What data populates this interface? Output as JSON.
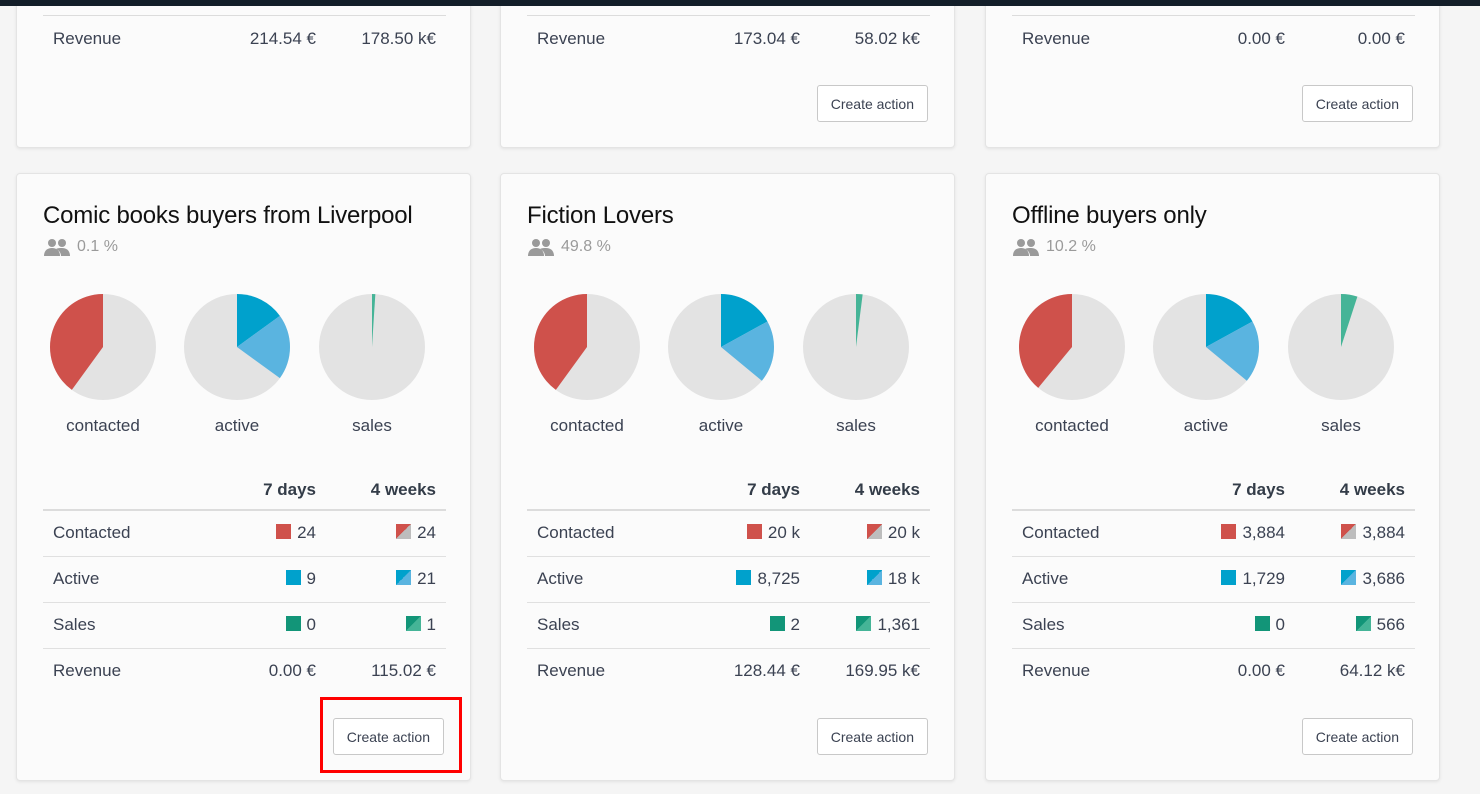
{
  "colors": {
    "contacted": "#cf514b",
    "contacted_secondary": "#bdbdbd",
    "active": "#00a1cc",
    "active_secondary": "#5ab4e0",
    "sales": "#129578",
    "sales_secondary": "#45b497",
    "pie_background": "#e3e3e3",
    "highlight": "#ff0000"
  },
  "columns": {
    "recent": "7 days",
    "period": "4 weeks"
  },
  "row_labels": {
    "contacted": "Contacted",
    "active": "Active",
    "sales": "Sales",
    "revenue": "Revenue"
  },
  "pie_labels": {
    "contacted": "contacted",
    "active": "active",
    "sales": "sales"
  },
  "create_action_label": "Create action",
  "top_cards": [
    {
      "revenue_7d": "214.54 €",
      "revenue_4w": "178.50 k€",
      "has_button": false
    },
    {
      "revenue_7d": "173.04 €",
      "revenue_4w": "58.02 k€",
      "has_button": true
    },
    {
      "revenue_7d": "0.00 €",
      "revenue_4w": "0.00 €",
      "has_button": true
    }
  ],
  "segments": [
    {
      "title": "Comic books buyers from Liverpool",
      "share": "0.1 %",
      "pies": {
        "contacted": 0.4,
        "active_recent": 0.15,
        "active_period": 0.2,
        "sales": 0.01
      },
      "contacted_7d": "24",
      "contacted_4w": "24",
      "active_7d": "9",
      "active_4w": "21",
      "sales_7d": "0",
      "sales_4w": "1",
      "revenue_7d": "0.00 €",
      "revenue_4w": "115.02 €",
      "highlighted": true
    },
    {
      "title": "Fiction Lovers",
      "share": "49.8 %",
      "pies": {
        "contacted": 0.4,
        "active_recent": 0.17,
        "active_period": 0.19,
        "sales": 0.02
      },
      "contacted_7d": "20 k",
      "contacted_4w": "20 k",
      "active_7d": "8,725",
      "active_4w": "18 k",
      "sales_7d": "2",
      "sales_4w": "1,361",
      "revenue_7d": "128.44 €",
      "revenue_4w": "169.95 k€",
      "highlighted": false
    },
    {
      "title": "Offline buyers only",
      "share": "10.2 %",
      "pies": {
        "contacted": 0.39,
        "active_recent": 0.17,
        "active_period": 0.19,
        "sales": 0.05
      },
      "contacted_7d": "3,884",
      "contacted_4w": "3,884",
      "active_7d": "1,729",
      "active_4w": "3,686",
      "sales_7d": "0",
      "sales_4w": "566",
      "revenue_7d": "0.00 €",
      "revenue_4w": "64.12 k€",
      "highlighted": false
    }
  ]
}
